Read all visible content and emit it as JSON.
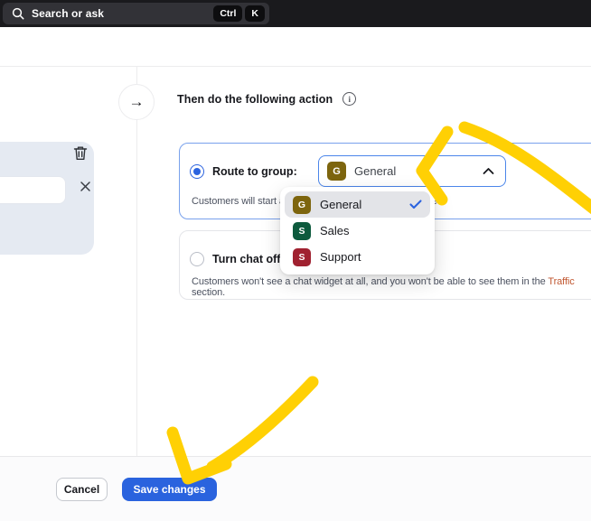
{
  "search_bar": {
    "placeholder": "Search or ask",
    "shortcut": [
      "Ctrl",
      "K"
    ]
  },
  "flow": {
    "node_arrow_glyph": "→",
    "heading": "Then do the following action"
  },
  "route_option": {
    "label": "Route to group:",
    "selected_group": "General",
    "selected_group_badge": {
      "letter": "G",
      "color": "#7d650e"
    },
    "description": "Customers will start a chat with the group you have picked"
  },
  "chat_off_option": {
    "label": "Turn chat off",
    "description_before_link": "Customers won't see a chat widget at all, and you won't be able to see them in the ",
    "description_link": "Traffic",
    "description_after_link": " section."
  },
  "group_dropdown": {
    "items": [
      {
        "label": "General",
        "badge_letter": "G",
        "badge_color": "#7d650e",
        "selected": true
      },
      {
        "label": "Sales",
        "badge_letter": "S",
        "badge_color": "#0d5a3d",
        "selected": false
      },
      {
        "label": "Support",
        "badge_letter": "S",
        "badge_color": "#a02130",
        "selected": false
      }
    ]
  },
  "footer": {
    "cancel_label": "Cancel",
    "save_label": "Save changes"
  },
  "icons": {
    "search": "magnifying-glass",
    "info": "info-circle",
    "info_glyph": "i",
    "trash": "trash-can",
    "close": "x-mark",
    "chevron": "chevron-up",
    "check": "checkmark",
    "annotation": "hand-drawn-arrow"
  },
  "colors": {
    "accent_blue": "#2b63df",
    "select_border_blue": "#4c86ea",
    "option_box_border_blue": "#79a1ec",
    "save_button_blue": "#2a63de",
    "annotation_yellow": "#ffd004",
    "link_orange": "#c0562f",
    "badge_general": "#7d650e",
    "badge_sales": "#0d5a3d",
    "badge_support": "#a02130",
    "topbar_background": "#1a1a1d",
    "left_panel_background": "#e5eaf2"
  }
}
